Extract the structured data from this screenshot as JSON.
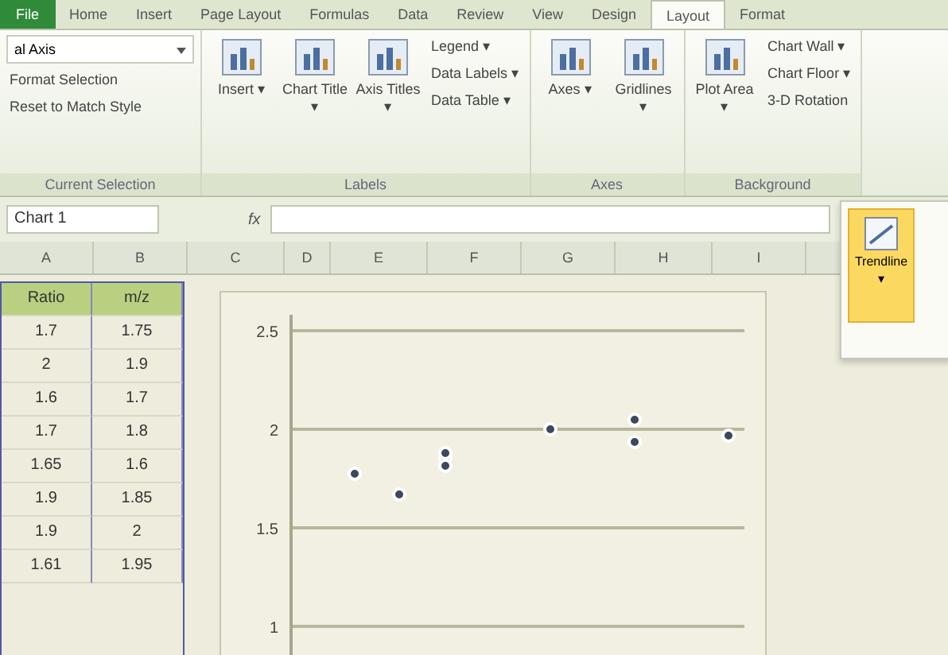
{
  "tabs": [
    {
      "label": "File",
      "selected": false
    },
    {
      "label": "Home",
      "selected": false
    },
    {
      "label": "Insert",
      "selected": false
    },
    {
      "label": "Page Layout",
      "selected": false
    },
    {
      "label": "Formulas",
      "selected": false
    },
    {
      "label": "Data",
      "selected": false
    },
    {
      "label": "Review",
      "selected": false
    },
    {
      "label": "View",
      "selected": false
    },
    {
      "label": "Design",
      "selected": false
    },
    {
      "label": "Layout",
      "selected": true
    },
    {
      "label": "Format",
      "selected": false
    }
  ],
  "current_selection": {
    "dropdown": "al Axis",
    "items": [
      "Format Selection",
      "Reset to Match Style"
    ],
    "group": "Current Selection"
  },
  "labels_group": {
    "big": [
      {
        "label": "Insert",
        "arrow": "▾"
      },
      {
        "label": "Chart Title",
        "arrow": "▾"
      },
      {
        "label": "Axis Titles",
        "arrow": "▾"
      }
    ],
    "small": [
      "Legend ▾",
      "Data Labels ▾",
      "Data Table ▾"
    ],
    "group": "Labels"
  },
  "axes_group": {
    "big": [
      {
        "label": "Axes",
        "arrow": "▾"
      },
      {
        "label": "Gridlines",
        "arrow": "▾"
      }
    ],
    "group": "Axes"
  },
  "background_group": {
    "big": [
      {
        "label": "Plot Area",
        "arrow": "▾"
      }
    ],
    "small": [
      "Chart Wall ▾",
      "Chart Floor ▾",
      "3-D Rotation"
    ],
    "group": "Background"
  },
  "name_box": "Chart 1",
  "fx": "fx",
  "columns": [
    "A",
    "B",
    "C",
    "D",
    "E",
    "F",
    "G",
    "H",
    "I"
  ],
  "table": {
    "headers": [
      "Ratio",
      "m/z"
    ],
    "rows": [
      [
        "1.7",
        "1.75"
      ],
      [
        "2",
        "1.9"
      ],
      [
        "1.6",
        "1.7"
      ],
      [
        "1.7",
        "1.8"
      ],
      [
        "1.65",
        "1.6"
      ],
      [
        "1.9",
        "1.85"
      ],
      [
        "1.9",
        "2"
      ],
      [
        "1.61",
        "1.95"
      ]
    ]
  },
  "trendline": {
    "label": "Trendline",
    "arrow": "▾"
  },
  "chart": {
    "kind": "picture",
    "axis_labels": [
      "2.5",
      "2",
      "1.5",
      "1"
    ]
  }
}
